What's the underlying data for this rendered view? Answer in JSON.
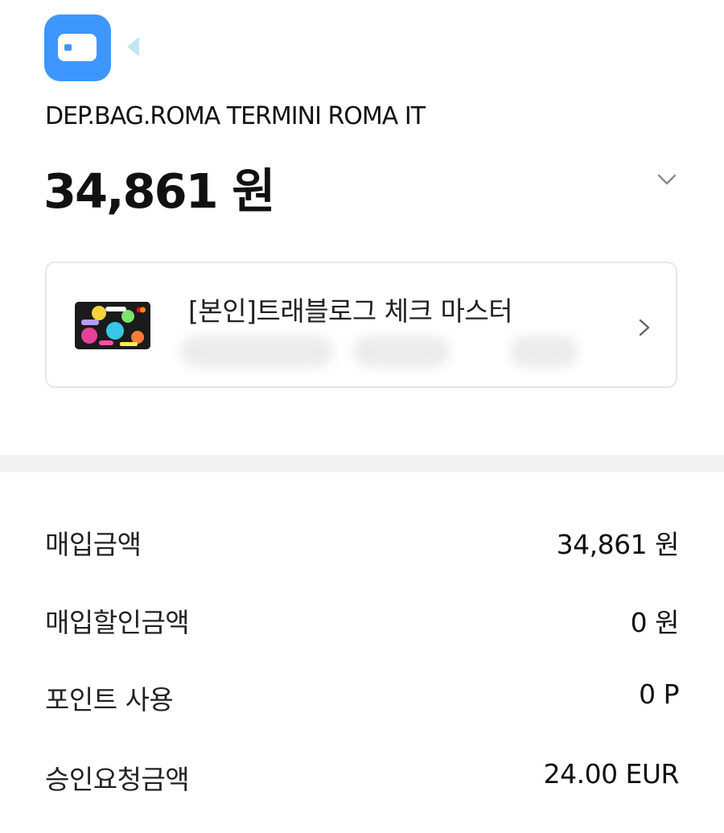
{
  "header": {
    "app_icon": "card-app-icon",
    "back_icon": "left-triangle-icon",
    "merchant": "DEP.BAG.ROMA TERMINI ROMA IT",
    "amount": "34,861 원",
    "expand_icon": "chevron-down-icon"
  },
  "card": {
    "name": "[본인]트래블로그 체크 마스터",
    "number_masked": "",
    "thumbnail_icon": "credit-card-thumbnail",
    "chevron_icon": "chevron-right-icon"
  },
  "details": [
    {
      "label": "매입금액",
      "value": "34,861 원"
    },
    {
      "label": "매입할인금액",
      "value": "0 원"
    },
    {
      "label": "포인트 사용",
      "value": "0 P"
    },
    {
      "label": "승인요청금액",
      "value": "24.00 EUR"
    }
  ],
  "colors": {
    "brand_blue": "#3e97ff",
    "tail_cyan": "#bfe8f2",
    "divider_gray": "#f3f3f3",
    "border_gray": "#e6e6e6"
  }
}
